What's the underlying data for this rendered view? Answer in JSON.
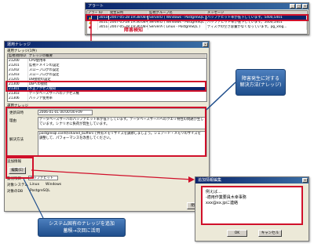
{
  "alert_window": {
    "title": "アラート",
    "columns": [
      "アラー",
      "ID",
      "発生日時",
      "監視グループ名",
      "メッセージ"
    ],
    "rows": [
      {
        "id": "30516",
        "time": "2007-05-28 19:38:08+09",
        "group": "ServerD ( Windows - PostgreSQL )",
        "message": "パッファヒット率が低下しています。5400,5401"
      },
      {
        "id": "30515",
        "time": "2007-05-28 19:36:08+09",
        "group": "ServerD ( Windows - PostgreSQL )",
        "message": "パッファヒット率が低下しています。5400,5401"
      },
      {
        "id": "30514",
        "time": "2007-05-28 19:36:08+09",
        "group": "ServerA ( Linux - PostgreSQL )",
        "message": "ディスクの空き容量がなくなっています。pg_xlog..."
      }
    ],
    "tag": "障害検知"
  },
  "knowledge_window": {
    "title": "運用ナレッジ",
    "list_group": "運用ナレッジ(1件)",
    "list_columns": [
      "監視項目ID",
      "ナレッジの概要"
    ],
    "list_rows": [
      {
        "id": "21200",
        "summary": "CPU使用率"
      },
      {
        "id": "21201",
        "summary": "監視ドメインの設定"
      },
      {
        "id": "21202",
        "summary": "スローブログの設定"
      },
      {
        "id": "21203",
        "summary": "スローブログの設定"
      },
      {
        "id": "21205",
        "summary": "DB接続の設定"
      },
      {
        "id": "21300",
        "summary": "DBへの接続"
      },
      {
        "id": "21301",
        "summary": "不正アクセス検知"
      },
      {
        "id": "21303",
        "summary": "データベースサーバのアクセス権"
      },
      {
        "id": "21306",
        "summary": "パッファ使用率"
      },
      {
        "id": "21310",
        "summary": "パッファヒット率"
      }
    ],
    "detail_group": "運用ナレッジ",
    "updated_label": "更新日時",
    "updated_value": "2006-01-01 00:00:00+09",
    "reason_label": "理由",
    "reason_value": "データベースサーバのパッファヒット率が低下しています。データベースサーバへのクエリ特性の問題が生じています。シナリオに負荷が発生しています。",
    "solution_label": "解決方法",
    "solution_value": "postgresql.confのshared_buffersで共有メモリサイズを調節しましょう。シェアード・メモリのサイズを調整して、パフォーマンスを改善してください。",
    "add_group": "追加情報",
    "edit_button": "編集(E)",
    "monitor_item_label": "監視項目",
    "monitor_item_value": "パッファヒット率",
    "target_system_label": "対象システム",
    "target_system_value": "Linux",
    "target_system_os": "Windows",
    "target_db_label": "対象のDB",
    "target_db_value": "PostgreSQL",
    "close_button": "閉じる"
  },
  "add_info_dialog": {
    "title": "追加情報編集",
    "text_line1": "例えば…",
    "text_line2": "-適用作業要員木幸事務",
    "text_line3": "xxx@xx.jpに連絡",
    "ok_button": "OK",
    "cancel_button": "キャンセル"
  },
  "callouts": {
    "knowledge": "障害発生に対する\n解決方法(ナレッジ)",
    "bottom_line1": "システム固有のナレッジを追加",
    "bottom_line2": "蓄積→次回に活用"
  },
  "colors": {
    "title_bar": "#0a246a",
    "highlight_red": "#d0102a",
    "callout_blue": "#1f4e8c"
  }
}
